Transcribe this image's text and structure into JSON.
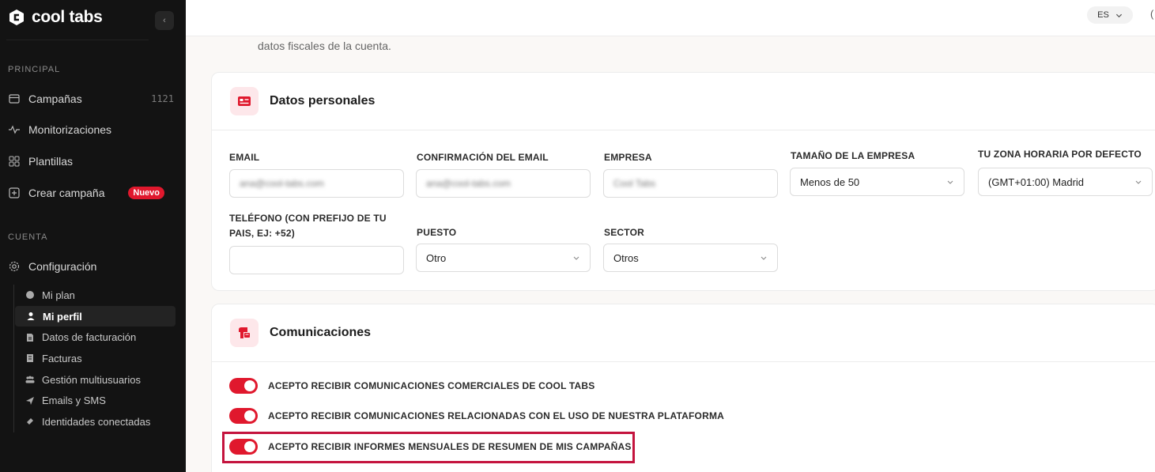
{
  "brand": {
    "name": "cool tabs"
  },
  "sidebar": {
    "sections": {
      "principal": "PRINCIPAL",
      "cuenta": "CUENTA"
    },
    "items": [
      {
        "label": "Campañas",
        "count": "1121",
        "icon": "browser-icon"
      },
      {
        "label": "Monitorizaciones",
        "icon": "activity-icon"
      },
      {
        "label": "Plantillas",
        "icon": "grid-icon"
      },
      {
        "label": "Crear campaña",
        "badge": "Nuevo",
        "icon": "plus-square-icon"
      },
      {
        "label": "Configuración",
        "icon": "gear-icon"
      }
    ],
    "subitems": [
      {
        "label": "Mi plan",
        "icon": "plan-icon"
      },
      {
        "label": "Mi perfil",
        "icon": "user-icon",
        "active": true
      },
      {
        "label": "Datos de facturación",
        "icon": "document-icon"
      },
      {
        "label": "Facturas",
        "icon": "invoice-icon"
      },
      {
        "label": "Gestión multiusuarios",
        "icon": "users-icon"
      },
      {
        "label": "Emails y SMS",
        "icon": "send-icon"
      },
      {
        "label": "Identidades conectadas",
        "icon": "link-icon"
      }
    ]
  },
  "topbar": {
    "language": "ES"
  },
  "intro_text": "datos fiscales de la cuenta.",
  "personal": {
    "title": "Datos personales",
    "fields": {
      "email": {
        "label": "EMAIL",
        "value": "ana@cool-tabs.com"
      },
      "email_confirm": {
        "label": "CONFIRMACIÓN DEL EMAIL",
        "value": "ana@cool-tabs.com"
      },
      "company": {
        "label": "EMPRESA",
        "value": "Cool Tabs"
      },
      "company_size": {
        "label": "TAMAÑO DE LA EMPRESA",
        "value": "Menos de 50"
      },
      "timezone": {
        "label": "TU ZONA HORARIA POR DEFECTO",
        "value": "(GMT+01:00) Madrid"
      },
      "phone": {
        "label_line1": "TELÉFONO (CON PREFIJO DE TU",
        "label_line2": "PAIS, EJ: +52)",
        "value": ""
      },
      "position": {
        "label": "PUESTO",
        "value": "Otro"
      },
      "sector": {
        "label": "SECTOR",
        "value": "Otros"
      }
    }
  },
  "communications": {
    "title": "Comunicaciones",
    "toggles": [
      {
        "label": "ACEPTO RECIBIR COMUNICACIONES COMERCIALES DE COOL TABS",
        "on": true
      },
      {
        "label": "ACEPTO RECIBIR COMUNICACIONES RELACIONADAS CON EL USO DE NUESTRA PLATAFORMA",
        "on": true
      },
      {
        "label": "ACEPTO RECIBIR INFORMES MENSUALES DE RESUMEN DE MIS CAMPAÑAS",
        "on": true
      }
    ]
  },
  "colors": {
    "accent": "#e0182d",
    "highlight": "#c4143e",
    "sidebar_bg": "#131313",
    "page_bg": "#faf8f6"
  }
}
